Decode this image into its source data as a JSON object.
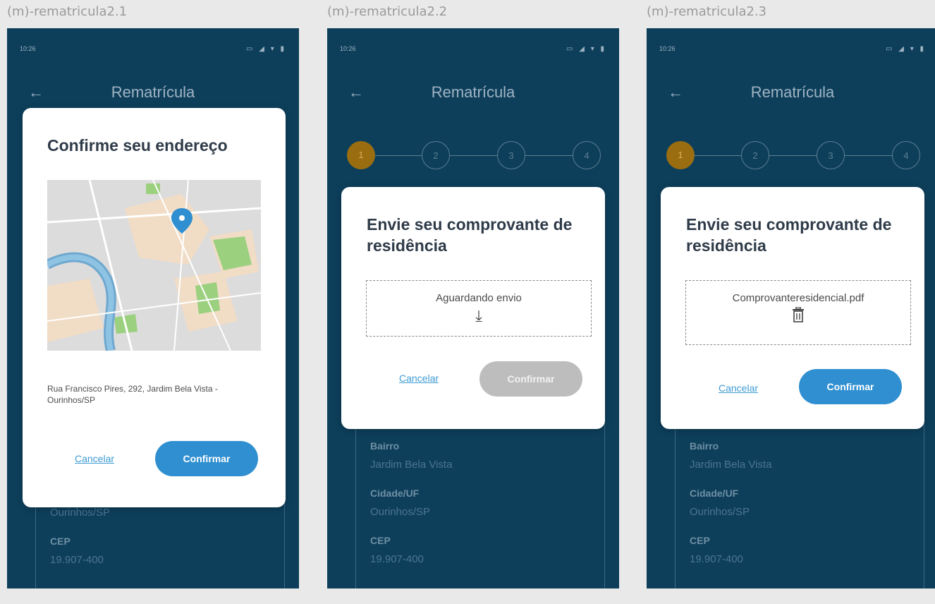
{
  "frames": [
    {
      "label": "(m)-rematricula2.1",
      "status_time": "10:26",
      "status_icons": "▭ ◢ ▾ ▮",
      "appbar_title": "Rematrícula",
      "fields": [
        {
          "label": "",
          "value": "Ourinhos/SP"
        },
        {
          "label": "CEP",
          "value": "19.907-400"
        }
      ],
      "dialog": {
        "title": "Confirme seu endereço",
        "address": "Rua Francisco Pires, 292, Jardim Bela Vista - Ourinhos/SP",
        "cancel": "Cancelar",
        "confirm": "Confirmar"
      }
    },
    {
      "label": "(m)-rematricula2.2",
      "status_time": "10:26",
      "status_icons": "▭ ◢ ▾ ▮",
      "appbar_title": "Rematrícula",
      "steps": [
        "1",
        "2",
        "3",
        "4"
      ],
      "fields": [
        {
          "label": "Bairro",
          "value": "Jardim Bela Vista"
        },
        {
          "label": "Cidade/UF",
          "value": "Ourinhos/SP"
        },
        {
          "label": "CEP",
          "value": "19.907-400"
        }
      ],
      "dialog": {
        "title": "Envie seu comprovante de residência",
        "dropzone_text": "Aguardando envio",
        "cancel": "Cancelar",
        "confirm": "Confirmar"
      }
    },
    {
      "label": "(m)-rematricula2.3",
      "status_time": "10:26",
      "status_icons": "▭ ◢ ▾ ▮",
      "appbar_title": "Rematrícula",
      "steps": [
        "1",
        "2",
        "3",
        "4"
      ],
      "fields": [
        {
          "label": "Bairro",
          "value": "Jardim Bela Vista"
        },
        {
          "label": "Cidade/UF",
          "value": "Ourinhos/SP"
        },
        {
          "label": "CEP",
          "value": "19.907-400"
        }
      ],
      "dialog": {
        "title": "Envie seu comprovante de residência",
        "dropzone_text": "Comprovanteresidencial.pdf",
        "cancel": "Cancelar",
        "confirm": "Confirmar"
      }
    }
  ],
  "colors": {
    "background": "#0d3f5b",
    "accent": "#2f8fd0",
    "step_active": "#9a6d10",
    "disabled": "#bdbdbd"
  },
  "icons": {
    "back": "arrow-left-icon",
    "download": "download-icon",
    "trash": "trash-icon",
    "pin": "map-pin-icon"
  }
}
